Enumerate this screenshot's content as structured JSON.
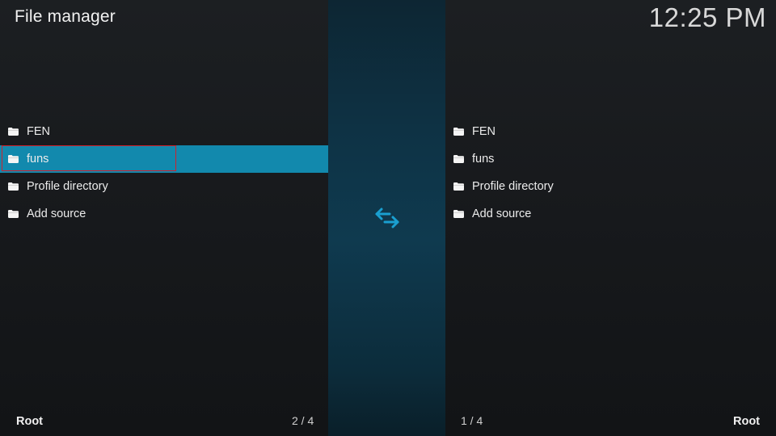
{
  "header": {
    "title": "File manager",
    "clock": "12:25 PM"
  },
  "left_pane": {
    "items": [
      {
        "label": "FEN",
        "icon": "folder-icon"
      },
      {
        "label": "funs",
        "icon": "folder-icon",
        "selected": true
      },
      {
        "label": "Profile directory",
        "icon": "folder-icon"
      },
      {
        "label": "Add source",
        "icon": "folder-icon"
      }
    ],
    "footer_label": "Root",
    "footer_count": "2 / 4"
  },
  "right_pane": {
    "items": [
      {
        "label": "FEN",
        "icon": "folder-icon"
      },
      {
        "label": "funs",
        "icon": "folder-icon"
      },
      {
        "label": "Profile directory",
        "icon": "folder-icon"
      },
      {
        "label": "Add source",
        "icon": "folder-icon"
      }
    ],
    "footer_label": "Root",
    "footer_count": "1 / 4"
  },
  "center": {
    "icon": "swap-arrows-icon"
  },
  "colors": {
    "selection": "#1289ad",
    "focus_outline": "#d0212c",
    "accent_icon": "#1a9fd0"
  }
}
